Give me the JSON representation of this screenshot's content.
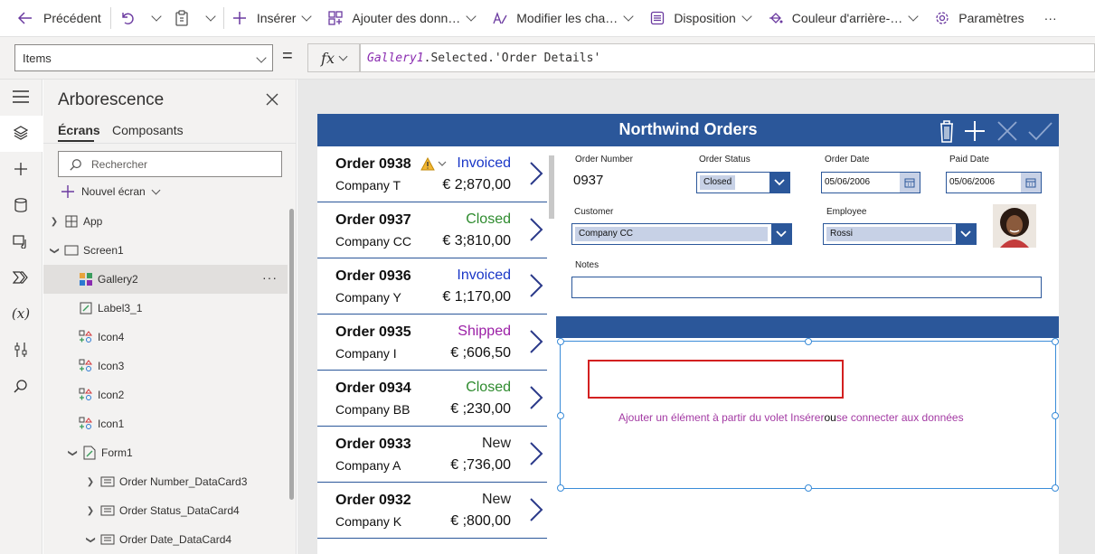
{
  "toolbar": {
    "back_label": "Précédent",
    "insert_label": "Insérer",
    "add_data_label": "Ajouter des donn…",
    "modify_fields_label": "Modifier les cha…",
    "layout_label": "Disposition",
    "background_label": "Couleur d'arrière-…",
    "settings_label": "Paramètres",
    "more_label": "···"
  },
  "formula_bar": {
    "property": "Items",
    "equals": "=",
    "fx_label": "fx",
    "formula_ident": "Gallery1",
    "formula_rest": ".Selected.'Order Details'"
  },
  "tree": {
    "title": "Arborescence",
    "tab_screens": "Écrans",
    "tab_components": "Composants",
    "search_placeholder": "Rechercher",
    "new_screen": "Nouvel écran",
    "nodes": [
      {
        "label": "App"
      },
      {
        "label": "Screen1"
      },
      {
        "label": "Gallery2"
      },
      {
        "label": "Label3_1"
      },
      {
        "label": "Icon4"
      },
      {
        "label": "Icon3"
      },
      {
        "label": "Icon2"
      },
      {
        "label": "Icon1"
      },
      {
        "label": "Form1"
      },
      {
        "label": "Order Number_DataCard3"
      },
      {
        "label": "Order Status_DataCard4"
      },
      {
        "label": "Order Date_DataCard4"
      }
    ],
    "more": "···"
  },
  "app": {
    "title": "Northwind Orders",
    "orders": [
      {
        "number": "Order 0938",
        "company": "Company T",
        "status": "Invoiced",
        "amount": "€ 2;870,00",
        "status_color": "#1a37c7"
      },
      {
        "number": "Order 0937",
        "company": "Company CC",
        "status": "Closed",
        "amount": "€ 3;810,00",
        "status_color": "#2e8b2e"
      },
      {
        "number": "Order 0936",
        "company": "Company Y",
        "status": "Invoiced",
        "amount": "€ 1;170,00",
        "status_color": "#1a37c7"
      },
      {
        "number": "Order 0935",
        "company": "Company I",
        "status": "Shipped",
        "amount": "€ ;606,50",
        "status_color": "#9b1fa6"
      },
      {
        "number": "Order 0934",
        "company": "Company BB",
        "status": "Closed",
        "amount": "€ ;230,00",
        "status_color": "#2e8b2e"
      },
      {
        "number": "Order 0933",
        "company": "Company A",
        "status": "New",
        "amount": "€ ;736,00",
        "status_color": "#111111"
      },
      {
        "number": "Order 0932",
        "company": "Company K",
        "status": "New",
        "amount": "€ ;800,00",
        "status_color": "#111111"
      }
    ],
    "form": {
      "order_number_label": "Order Number",
      "order_number_value": "0937",
      "order_status_label": "Order Status",
      "order_status_value": "Closed",
      "order_date_label": "Order Date",
      "order_date_value": "05/06/2006",
      "paid_date_label": "Paid Date",
      "paid_date_value": "05/06/2006",
      "customer_label": "Customer",
      "customer_value": "Company CC",
      "employee_label": "Employee",
      "employee_value": "Rossi",
      "notes_label": "Notes",
      "notes_value": ""
    },
    "subgallery_hint_link": "Ajouter un élément à partir du volet Insérer",
    "subgallery_hint_or": "ou",
    "subgallery_hint_connect": "se connecter aux données"
  },
  "colors": {
    "header_blue": "#2b579a",
    "selection_outline": "#3a8cd8",
    "highlight_red": "#d32020"
  }
}
